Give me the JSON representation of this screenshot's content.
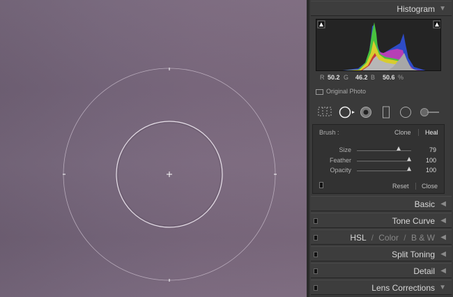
{
  "histogram": {
    "title": "Histogram",
    "r_label": "R",
    "r_value": "50.2",
    "g_label": "G",
    "g_value": "46.2",
    "b_label": "B",
    "b_value": "50.6",
    "percent": "%",
    "original_photo": "Original Photo"
  },
  "brush": {
    "label": "Brush :",
    "clone": "Clone",
    "heal": "Heal",
    "size_label": "Size",
    "size_value": "79",
    "feather_label": "Feather",
    "feather_value": "100",
    "opacity_label": "Opacity",
    "opacity_value": "100",
    "size_level": 0.79,
    "feather_level": 1.0,
    "opacity_level": 1.0,
    "reset": "Reset",
    "close": "Close"
  },
  "panels": {
    "basic": "Basic",
    "tone_curve": "Tone Curve",
    "hsl": "HSL",
    "slash1": "/",
    "color": "Color",
    "slash2": "/",
    "bw": "B & W",
    "split_toning": "Split Toning",
    "detail": "Detail",
    "lens_corrections": "Lens Corrections"
  },
  "colors": {
    "panel_bg": "#3a3a3a",
    "canvas": "#75657a",
    "text": "#d8d8d8",
    "muted": "#8a8a8a"
  }
}
